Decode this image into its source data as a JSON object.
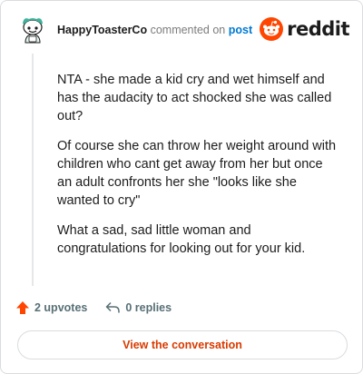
{
  "header": {
    "username": "HappyToasterCo",
    "commented_text": "commented on",
    "post_link": "post",
    "brand": "reddit"
  },
  "avatar": {
    "icon": "snoo-avatar-icon"
  },
  "comment": {
    "paragraphs": [
      "NTA - she made a kid cry and wet himself and has the audacity to act shocked she was called out?",
      "Of course she can throw her weight around with children who cant get away from her but once an adult confronts her she \"looks like she wanted to cry\"",
      "What a sad, sad little woman and congratulations for looking out for your kid."
    ]
  },
  "actions": {
    "upvotes": "2 upvotes",
    "replies": "0 replies"
  },
  "button": {
    "view_conversation": "View the conversation"
  },
  "colors": {
    "accent": "#d93a00",
    "upvote": "#ff4500",
    "link": "#0079d3",
    "avatar_bg": "#7ac6b5"
  }
}
